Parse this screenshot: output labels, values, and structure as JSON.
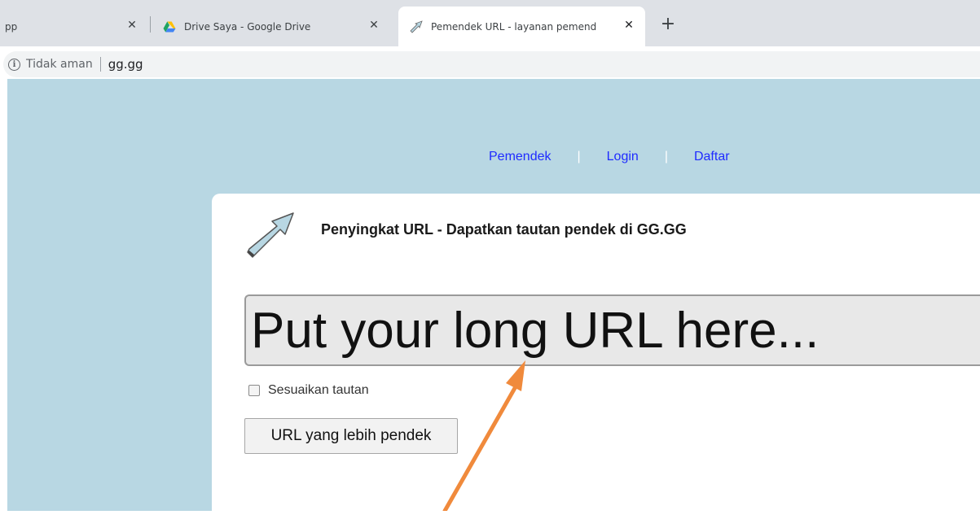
{
  "browser": {
    "tabs": [
      {
        "title": "pp",
        "active": false
      },
      {
        "title": "Drive Saya - Google Drive",
        "active": false
      },
      {
        "title": "Pemendek URL - layanan pemend",
        "active": true
      }
    ],
    "close_glyph": "✕",
    "new_tab_glyph": "+",
    "security_label": "Tidak aman",
    "info_glyph": "i",
    "url": "gg.gg"
  },
  "nav": {
    "items": [
      "Pemendek",
      "Login",
      "Daftar"
    ],
    "separator": "|"
  },
  "main": {
    "headline": "Penyingkat URL - Dapatkan tautan pendek di GG.GG",
    "input_placeholder": "Put your long URL here...",
    "custom_label": "Sesuaikan tautan",
    "shorten_button": "URL yang lebih pendek"
  },
  "colors": {
    "page_background": "#b8d7e3",
    "nav_link": "#1f2bff",
    "annotation_arrow": "#f08a3c"
  },
  "icons": {
    "drive_tab": "google-drive-icon",
    "active_tab": "arrow-favicon-icon",
    "logo": "arrow-logo-icon",
    "security": "info-icon",
    "annotation": "orange-pointer-arrow"
  }
}
